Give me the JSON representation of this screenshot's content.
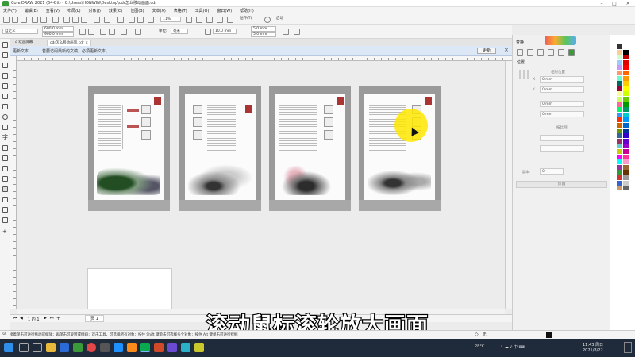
{
  "window": {
    "title": "CorelDRAW 2021 (64-Bit) - C:\\Users\\HONWIN\\Desktop\\cdr怎么移动画面.cdr"
  },
  "menu": [
    "文件(F)",
    "编辑(E)",
    "查看(V)",
    "布局(L)",
    "对象(J)",
    "效果(C)",
    "位图(B)",
    "文本(X)",
    "表格(T)",
    "工具(O)",
    "窗口(W)",
    "帮助(H)"
  ],
  "toolbar": {
    "zoom": "11%",
    "snap": "贴齐(T)",
    "launch": "启动"
  },
  "propertybar": {
    "preset": "自定义",
    "width": "600.0 mm",
    "height": "900.0 mm",
    "units_label": "单位:",
    "units": "毫米",
    "nudge": "10.0 mm",
    "dup_x": "5.0 mm",
    "dup_y": "5.0 mm"
  },
  "tabs": {
    "home": "欢迎屏幕",
    "doc": "cdr怎么移动画面.cdr"
  },
  "infobar": {
    "label": "更新文本",
    "message": "若要访问最新的文稿，必须更新文本。",
    "button": "更新"
  },
  "pages": {
    "nav": "1 的 1",
    "tab": "页 1"
  },
  "status": {
    "hint": "接着单击可进行拖动或缩放；再单击可旋转或倾斜；双击工具，可选择所有对象；按住 Shift 键单击可选择多个对象；按住 Alt 键单击可进行挖掘",
    "fill": "无"
  },
  "docker": {
    "title": "变换",
    "section": "位置",
    "relative": "相对位置",
    "x": "0 mm",
    "y": "0 mm",
    "w": "0 mm",
    "h": "0 mm",
    "proportional": "按比例",
    "copies_label": "副本:",
    "copies": "0",
    "apply": "应用"
  },
  "caption": "滚动鼠标滚轮放大画面",
  "clock": {
    "time": "11:43 周日",
    "date": "2021/8/22"
  },
  "tray": {
    "weather": "28°C"
  },
  "colors": {
    "accent": "#1f2a3a",
    "infobar": "#dde8f6",
    "highlight": "#ffe600"
  },
  "palette": [
    "#ffffff",
    "#000000",
    "#c00000",
    "#e00000",
    "#ff0000",
    "#ff6600",
    "#ff9900",
    "#ffcc00",
    "#ffff00",
    "#ccff00",
    "#66cc00",
    "#009900",
    "#009966",
    "#00cccc",
    "#0099ff",
    "#0066cc",
    "#003399",
    "#3300cc",
    "#6600cc",
    "#9900cc",
    "#cc0099",
    "#ff3399",
    "#ff99cc",
    "#996633",
    "#663300",
    "#999999",
    "#cccccc",
    "#666666",
    "#333333",
    "#ffcc99",
    "#ccffcc",
    "#99ccff",
    "#cc99ff",
    "#ff9966",
    "#66ffcc",
    "#006666",
    "#990033",
    "#ffff99",
    "#ccff66",
    "#ff6699",
    "#00ff66",
    "#3399ff",
    "#ff3300",
    "#cc6600",
    "#669900",
    "#336699",
    "#993366",
    "#66cccc",
    "#cccc00",
    "#ff00ff",
    "#00ffff",
    "#993399",
    "#339933",
    "#cc3333",
    "#3366cc",
    "#cc9966"
  ]
}
